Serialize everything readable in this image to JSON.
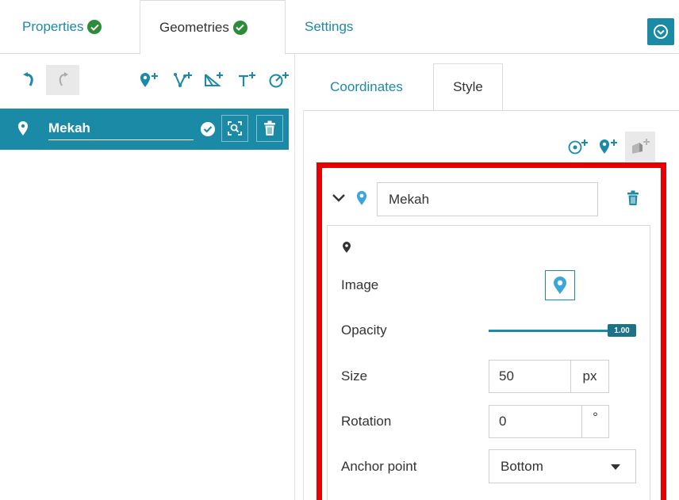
{
  "tabs": [
    {
      "label": "Properties",
      "has_check": true,
      "active": false
    },
    {
      "label": "Geometries",
      "has_check": true,
      "active": true
    },
    {
      "label": "Settings",
      "has_check": false,
      "active": false
    }
  ],
  "toolbar": {
    "undo_icon": "undo-icon",
    "redo_icon": "redo-icon",
    "add_point_icon": "add-marker-icon",
    "add_line_icon": "add-line-icon",
    "add_polygon_icon": "add-polygon-icon",
    "add_text_icon": "add-text-icon",
    "add_circle_icon": "add-circle-icon",
    "collapse_icon": "collapse-circle-icon"
  },
  "geometries": [
    {
      "name": "Mekah",
      "icon": "marker-icon"
    }
  ],
  "inner_tabs": [
    {
      "label": "Coordinates",
      "active": false
    },
    {
      "label": "Style",
      "active": true
    }
  ],
  "style_toolbar": [
    "add-circle-style-icon",
    "add-marker-style-icon",
    "add-3d-style-icon"
  ],
  "style_item": {
    "name": "Mekah",
    "image_label": "Image",
    "opacity_label": "Opacity",
    "opacity_value": "1.00",
    "size_label": "Size",
    "size_value": "50",
    "size_unit": "px",
    "rotation_label": "Rotation",
    "rotation_value": "0",
    "rotation_unit": "°",
    "anchor_label": "Anchor point",
    "anchor_value": "Bottom"
  },
  "colors": {
    "accent": "#1b8aa6",
    "check": "#2e8b3a",
    "highlight": "#e60000"
  }
}
